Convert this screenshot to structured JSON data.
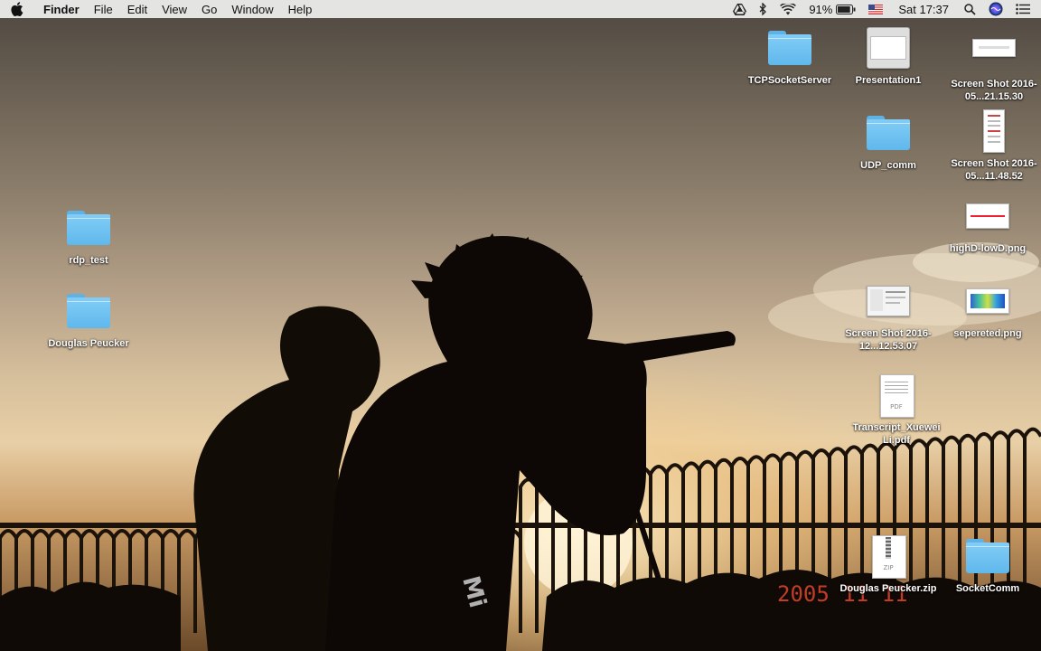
{
  "menubar": {
    "apple_icon": "apple-logo-icon",
    "app_name": "Finder",
    "menus": [
      "File",
      "Edit",
      "View",
      "Go",
      "Window",
      "Help"
    ],
    "status": {
      "drive_icon": "google-drive-icon",
      "bluetooth_icon": "bluetooth-icon",
      "wifi_icon": "wifi-icon",
      "battery_percent": "91%",
      "battery_level": 0.91,
      "flag_icon": "us-flag-input-source-icon",
      "clock": "Sat 17:37",
      "spotlight_icon": "spotlight-search-icon",
      "siri_icon": "siri-icon",
      "notification_icon": "notification-center-icon"
    }
  },
  "desktop": {
    "items": [
      {
        "kind": "folder",
        "label": "TCPSocketServer"
      },
      {
        "kind": "presentation",
        "label": "Presentation1"
      },
      {
        "kind": "screenshot-wide",
        "label": "Screen Shot 2016-05...21.15.30"
      },
      {
        "kind": "folder",
        "label": "UDP_comm"
      },
      {
        "kind": "screenshot-tall",
        "label": "Screen Shot 2016-05...11.48.52"
      },
      {
        "kind": "image-plot",
        "label": "highD-lowD.png"
      },
      {
        "kind": "screenshot",
        "label": "Screen Shot 2016-12...12.53.07"
      },
      {
        "kind": "image-heatmap",
        "label": "sepereted.png"
      },
      {
        "kind": "pdf",
        "label": "Transcript_Xuewei Li.pdf",
        "ext": "PDF"
      },
      {
        "kind": "folder",
        "label": "rdp_test"
      },
      {
        "kind": "folder",
        "label": "Douglas Peucker"
      },
      {
        "kind": "zip",
        "label": "Douglas Peucker.zip",
        "ext": "ZIP"
      },
      {
        "kind": "folder",
        "label": "SocketComm"
      }
    ]
  },
  "wallpaper": {
    "description_icon": "wallpaper-photo",
    "date_stamp": "2005 11 11"
  },
  "colors": {
    "menubar_bg": "#eaeaea",
    "folder_blue": "#6cc1f0",
    "sky_top": "#4e4740",
    "sky_glow": "#e8cfa6"
  }
}
